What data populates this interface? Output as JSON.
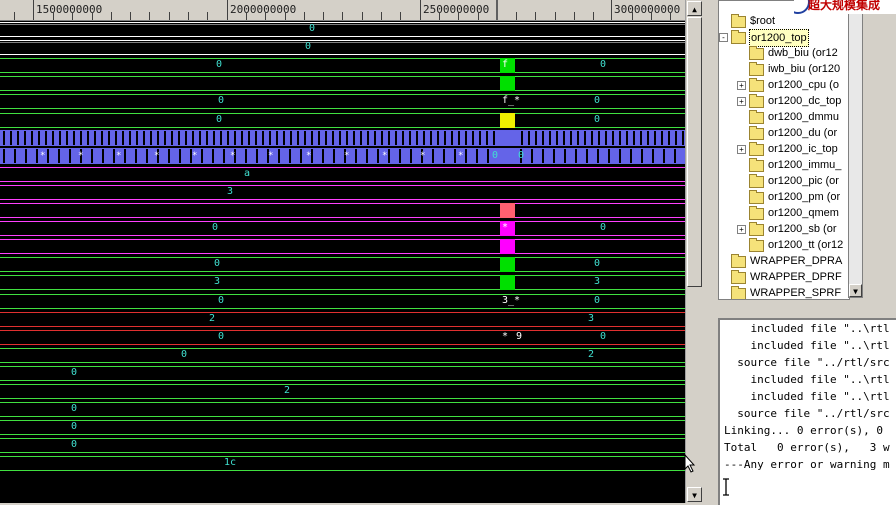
{
  "ruler": {
    "labels": [
      "1500000000",
      "2000000000",
      "2500000000",
      "3000000000"
    ]
  },
  "waveform": {
    "rows": [
      {
        "text": "0",
        "color": "#ffffff",
        "type": "double"
      },
      {
        "text": "0",
        "color": "#ffffff",
        "type": "double"
      },
      {
        "text": "0",
        "color": "#40e040",
        "type": "bus",
        "mark": "#00e000",
        "mtext": "f",
        "after": "0"
      },
      {
        "text": "",
        "color": "#40e040",
        "type": "bus",
        "mark": "#00e000"
      },
      {
        "text": "0",
        "color": "#40e040",
        "type": "bus",
        "mtext": "f_*",
        "after": "0"
      },
      {
        "text": "0",
        "color": "#40e040",
        "type": "bus",
        "mark": "#f0f000",
        "after": "0"
      },
      {
        "text": "",
        "color": "#7070ff",
        "type": "dense"
      },
      {
        "text": "0",
        "color": "#7070ff",
        "type": "dense2",
        "after": "0"
      },
      {
        "text": "a",
        "color": "#ff40ff",
        "type": "bus"
      },
      {
        "text": "3",
        "color": "#ff40ff",
        "type": "bus"
      },
      {
        "text": "",
        "color": "#ff40ff",
        "type": "bus",
        "mark": "#ff6070"
      },
      {
        "text": "0",
        "color": "#ff40ff",
        "type": "bus",
        "mark": "#ff00ff",
        "mtext": "*",
        "after": "0"
      },
      {
        "text": "",
        "color": "#ff40ff",
        "type": "bus",
        "mark": "#ff00ff"
      },
      {
        "text": "0",
        "color": "#40e040",
        "type": "bus",
        "mark": "#00e000",
        "after": "0"
      },
      {
        "text": "3",
        "color": "#40e040",
        "type": "bus",
        "mark": "#00e000",
        "after": "3"
      },
      {
        "text": "0",
        "color": "#40e040",
        "type": "bus",
        "mtext": "3_*",
        "after": "0"
      },
      {
        "text": "2",
        "color": "#e03030",
        "type": "bus",
        "after": "3"
      },
      {
        "text": "0",
        "color": "#e03030",
        "type": "bus",
        "mtext": "*",
        "mtext2": "9",
        "after": "0"
      },
      {
        "text": "0",
        "color": "#40e040",
        "type": "bus",
        "after": "2"
      },
      {
        "text": "0",
        "color": "#40e040",
        "type": "bus"
      },
      {
        "text": "2",
        "color": "#40e040",
        "type": "bus"
      },
      {
        "text": "0",
        "color": "#40e040",
        "type": "bus"
      },
      {
        "text": "0",
        "color": "#40e040",
        "type": "bus"
      },
      {
        "text": "0",
        "color": "#40e040",
        "type": "bus"
      },
      {
        "text": "1c",
        "color": "#40e040",
        "type": "bus"
      }
    ]
  },
  "tree": {
    "items": [
      {
        "label": "$root",
        "expander": "",
        "indent": 0
      },
      {
        "label": "or1200_top",
        "expander": "-",
        "indent": 0,
        "selected": true
      },
      {
        "label": "dwb_biu (or12",
        "expander": "",
        "indent": 1
      },
      {
        "label": "iwb_biu (or120",
        "expander": "",
        "indent": 1
      },
      {
        "label": "or1200_cpu (o",
        "expander": "+",
        "indent": 1
      },
      {
        "label": "or1200_dc_top",
        "expander": "+",
        "indent": 1
      },
      {
        "label": "or1200_dmmu",
        "expander": "",
        "indent": 1
      },
      {
        "label": "or1200_du (or",
        "expander": "",
        "indent": 1
      },
      {
        "label": "or1200_ic_top",
        "expander": "+",
        "indent": 1
      },
      {
        "label": "or1200_immu_",
        "expander": "",
        "indent": 1
      },
      {
        "label": "or1200_pic (or",
        "expander": "",
        "indent": 1
      },
      {
        "label": "or1200_pm (or",
        "expander": "",
        "indent": 1
      },
      {
        "label": "or1200_qmem",
        "expander": "",
        "indent": 1
      },
      {
        "label": "or1200_sb (or",
        "expander": "+",
        "indent": 1
      },
      {
        "label": "or1200_tt (or12",
        "expander": "",
        "indent": 1
      },
      {
        "label": "WRAPPER_DPRA",
        "expander": "",
        "indent": 0
      },
      {
        "label": "WRAPPER_DPRF",
        "expander": "",
        "indent": 0
      },
      {
        "label": "WRAPPER_SPRF",
        "expander": "",
        "indent": 0
      }
    ]
  },
  "console": {
    "lines": [
      "    included file \"..\\rtl",
      "    included file \"..\\rtl",
      "  source file \"../rtl/src",
      "    included file \"..\\rtl",
      "    included file \"..\\rtl",
      "  source file \"../rtl/src",
      "Linking... 0 error(s), 0",
      "Total   0 error(s),   3 w",
      "---Any error or warning m"
    ]
  },
  "logo": {
    "text": "超大规模集成"
  }
}
